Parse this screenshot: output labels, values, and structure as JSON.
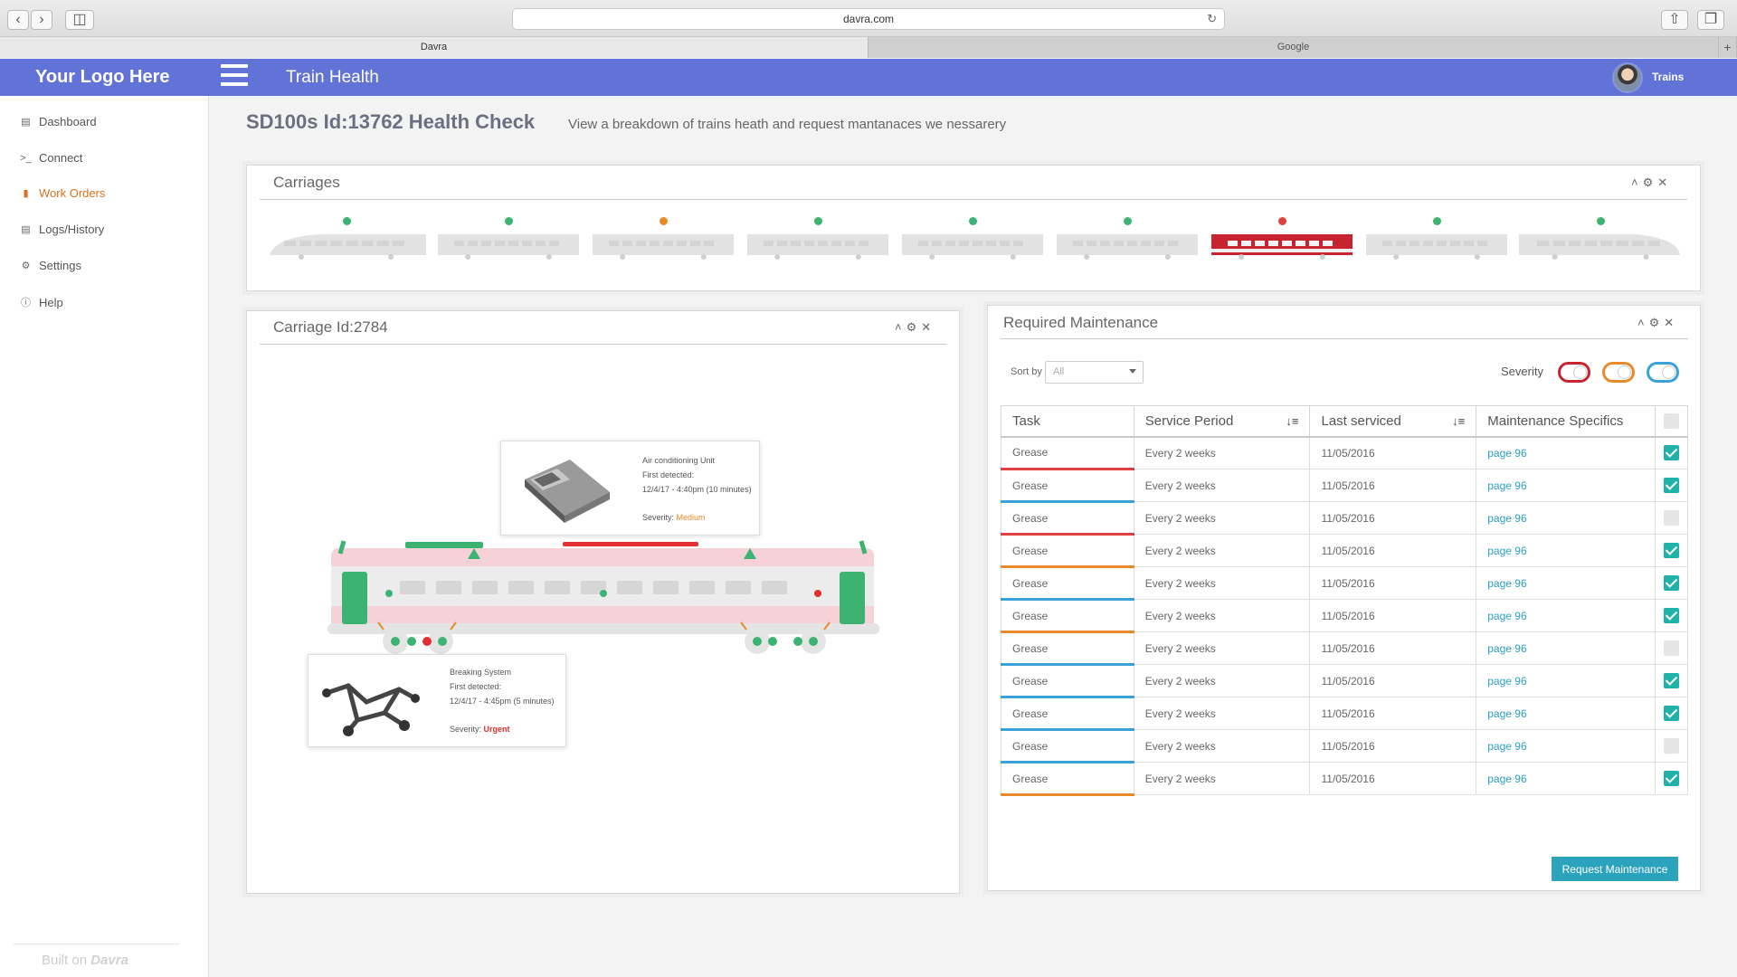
{
  "browser": {
    "url": "davra.com",
    "tabs": [
      {
        "label": "Davra"
      },
      {
        "label": "Google"
      }
    ]
  },
  "header": {
    "logo": "Your Logo Here",
    "title": "Train Health",
    "user": "Trains"
  },
  "sidebar": {
    "items": [
      {
        "label": "Dashboard",
        "icon": "chart-icon"
      },
      {
        "label": "Connect",
        "icon": "terminal-icon"
      },
      {
        "label": "Work Orders",
        "icon": "briefcase-icon"
      },
      {
        "label": "Logs/History",
        "icon": "document-icon"
      },
      {
        "label": "Settings",
        "icon": "gear-icon"
      },
      {
        "label": "Help",
        "icon": "info-icon"
      }
    ],
    "active": "Work Orders",
    "built_on": "Built on",
    "built_on_brand": "Davra"
  },
  "page": {
    "title": "SD100s Id:13762 Health Check",
    "subtitle": "View a breakdown of trains heath and request mantanaces we nessarery"
  },
  "carriages": {
    "title": "Carriages",
    "items": [
      {
        "status": "green",
        "selected": false,
        "shape": "front"
      },
      {
        "status": "green",
        "selected": false,
        "shape": "middle"
      },
      {
        "status": "orange",
        "selected": false,
        "shape": "middle"
      },
      {
        "status": "green",
        "selected": false,
        "shape": "middle"
      },
      {
        "status": "green",
        "selected": false,
        "shape": "middle"
      },
      {
        "status": "green",
        "selected": false,
        "shape": "middle"
      },
      {
        "status": "red",
        "selected": true,
        "shape": "middle"
      },
      {
        "status": "green",
        "selected": false,
        "shape": "middle"
      },
      {
        "status": "green",
        "selected": false,
        "shape": "rear"
      }
    ]
  },
  "carriage_detail": {
    "title": "Carriage Id:2784",
    "callouts": [
      {
        "name": "Air conditioning Unit",
        "detected_label": "First detected:",
        "detected": "12/4/17 - 4:40pm (10 minutes)",
        "severity_label": "Severity:",
        "severity": "Medium"
      },
      {
        "name": "Breaking System",
        "detected_label": "First detected:",
        "detected": "12/4/17 - 4:45pm (5 minutes)",
        "severity_label": "Severity:",
        "severity": "Urgent"
      }
    ]
  },
  "maintenance": {
    "title": "Required  Maintenance",
    "sort_label": "Sort by",
    "sort_value": "All",
    "severity_label": "Severity",
    "columns": [
      "Task",
      "Service Period",
      "Last serviced",
      "Maintenance Specifics"
    ],
    "rows": [
      {
        "task": "Grease",
        "period": "Every 2 weeks",
        "last": "11/05/2016",
        "spec": "page 96",
        "severity": "red",
        "checked": true
      },
      {
        "task": "Grease",
        "period": "Every 2 weeks",
        "last": "11/05/2016",
        "spec": "page 96",
        "severity": "blue",
        "checked": true
      },
      {
        "task": "Grease",
        "period": "Every 2 weeks",
        "last": "11/05/2016",
        "spec": "page 96",
        "severity": "red",
        "checked": false
      },
      {
        "task": "Grease",
        "period": "Every 2 weeks",
        "last": "11/05/2016",
        "spec": "page 96",
        "severity": "orange",
        "checked": true
      },
      {
        "task": "Grease",
        "period": "Every 2 weeks",
        "last": "11/05/2016",
        "spec": "page 96",
        "severity": "blue",
        "checked": true
      },
      {
        "task": "Grease",
        "period": "Every 2 weeks",
        "last": "11/05/2016",
        "spec": "page 96",
        "severity": "orange",
        "checked": true
      },
      {
        "task": "Grease",
        "period": "Every 2 weeks",
        "last": "11/05/2016",
        "spec": "page 96",
        "severity": "blue",
        "checked": false
      },
      {
        "task": "Grease",
        "period": "Every 2 weeks",
        "last": "11/05/2016",
        "spec": "page 96",
        "severity": "blue",
        "checked": true
      },
      {
        "task": "Grease",
        "period": "Every 2 weeks",
        "last": "11/05/2016",
        "spec": "page 96",
        "severity": "blue",
        "checked": true
      },
      {
        "task": "Grease",
        "period": "Every 2 weeks",
        "last": "11/05/2016",
        "spec": "page 96",
        "severity": "blue",
        "checked": false
      },
      {
        "task": "Grease",
        "period": "Every 2 weeks",
        "last": "11/05/2016",
        "spec": "page 96",
        "severity": "orange",
        "checked": true
      }
    ],
    "request_button": "Request Maintenance"
  },
  "colors": {
    "brand": "#6173d6",
    "red": "#e04040",
    "orange": "#e88a2a",
    "blue": "#3aa0d8",
    "green": "#3cb371",
    "teal": "#20b2aa",
    "accent_link": "#2a9fbf"
  }
}
